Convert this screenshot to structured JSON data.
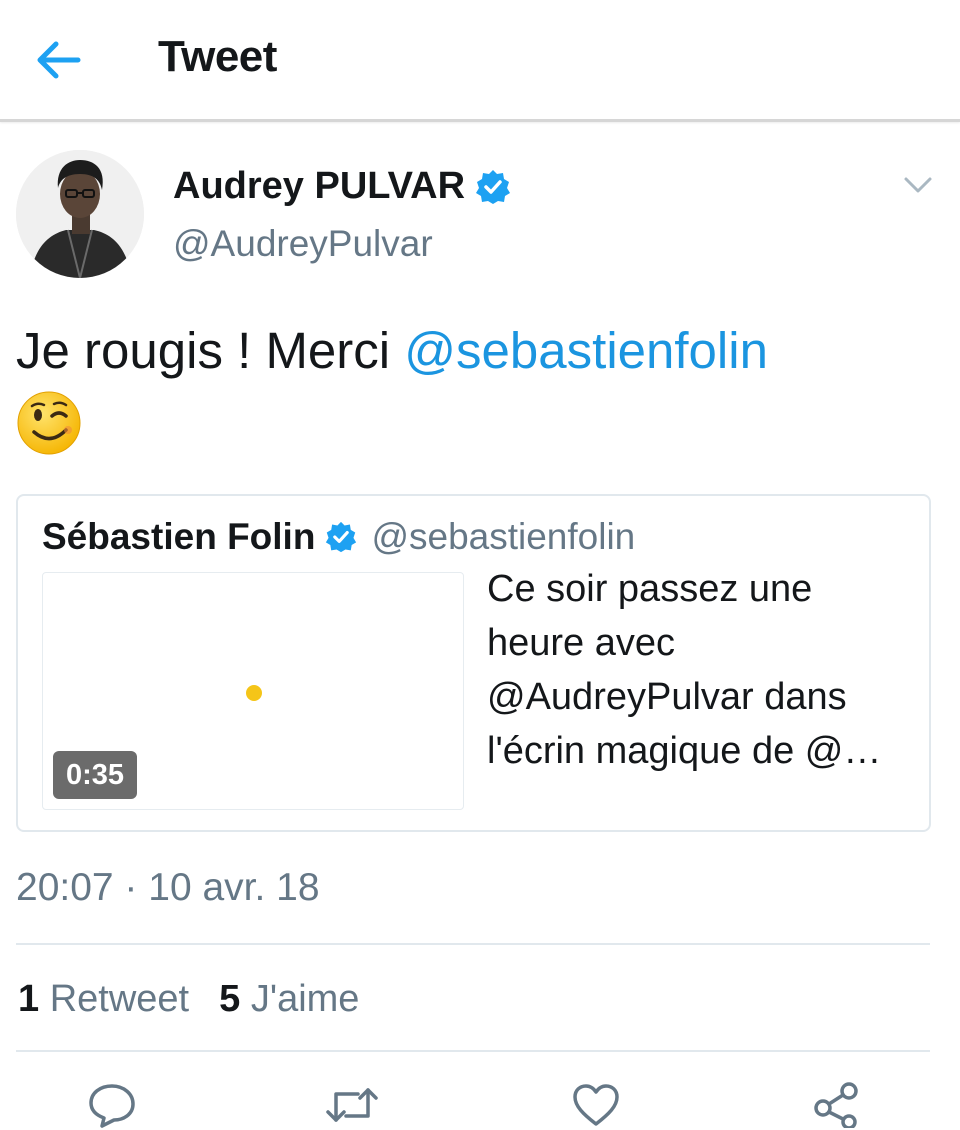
{
  "header": {
    "title": "Tweet",
    "back_icon": "back-arrow-icon",
    "accent": "#1da1f2"
  },
  "tweet": {
    "author_name": "Audrey PULVAR",
    "author_handle": "@AudreyPulvar",
    "verified": true,
    "text_prefix": "Je rougis ! Merci ",
    "mention": "@sebastienfolin",
    "emoji": "winking-face",
    "timestamp": "20:07 · 10 avr. 18"
  },
  "quote": {
    "author_name": "Sébastien Folin",
    "author_handle": "@sebastienfolin",
    "verified": true,
    "text": "Ce soir passez une heure avec @AudreyPulvar dans l'écrin magique de @…",
    "video_duration": "0:35"
  },
  "stats": {
    "retweets_count": "1",
    "retweets_label": "Retweet",
    "likes_count": "5",
    "likes_label": "J'aime"
  },
  "actions": [
    "reply-icon",
    "retweet-icon",
    "like-icon",
    "share-icon"
  ],
  "colors": {
    "link": "#1b95e0",
    "verified": "#1da1f2",
    "secondary_text": "#657786",
    "action_icon": "#657786"
  }
}
